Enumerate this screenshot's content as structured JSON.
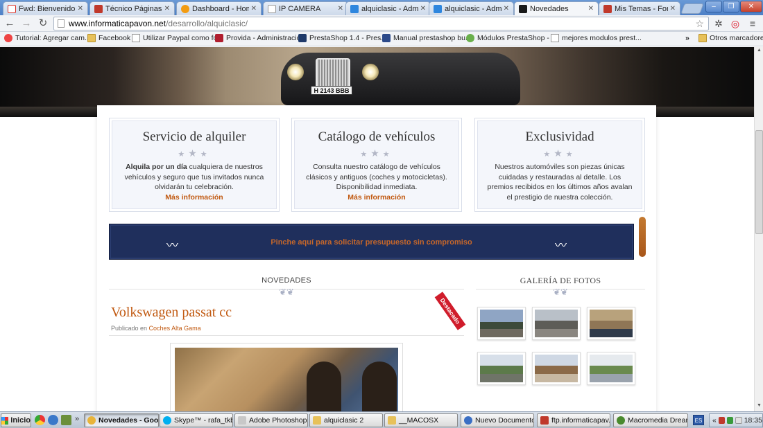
{
  "browser": {
    "tabs": [
      {
        "title": "Fwd: Bienvenido! Pr",
        "favicon_color": "#d93025",
        "active": false
      },
      {
        "title": "Técnico Páginas Joo",
        "favicon_color": "#c0392b",
        "active": false
      },
      {
        "title": "Dashboard - Home",
        "favicon_color": "#f39c12",
        "active": false
      },
      {
        "title": "IP CAMERA",
        "favicon_color": "#ffffff",
        "active": false
      },
      {
        "title": "alquiclasic - Administ",
        "favicon_color": "#2e86de",
        "active": false
      },
      {
        "title": "alquiclasic - Administ",
        "favicon_color": "#2e86de",
        "active": false
      },
      {
        "title": "Novedades",
        "favicon_color": "#1a1a1a",
        "active": true
      },
      {
        "title": "Mis Temas - Foro Jo",
        "favicon_color": "#c0392b",
        "active": false
      }
    ],
    "url_host": "www.informaticapavon.net",
    "url_path": "/desarrollo/alquiclasic/",
    "bookmarks": [
      {
        "label": "Tutorial: Agregar cam...",
        "icon": "joomla-icon"
      },
      {
        "label": "Facebook",
        "icon": "folder-icon"
      },
      {
        "label": "Utilizar Paypal como fo...",
        "icon": "page-icon"
      },
      {
        "label": "Provida - Administración",
        "icon": "provida-icon"
      },
      {
        "label": "PrestaShop 1.4 - Pres...",
        "icon": "prestashop-icon"
      },
      {
        "label": "Manual prestashop bu...",
        "icon": "manual-icon"
      },
      {
        "label": "Módulos PrestaShop - ...",
        "icon": "modules-icon"
      },
      {
        "label": "mejores modulos prest...",
        "icon": "page-icon"
      }
    ],
    "bookmarks_overflow": "»",
    "other_bookmarks": "Otros marcadores"
  },
  "page": {
    "hero_plate": "H 2143 BBB",
    "cards": [
      {
        "title": "Servicio de alquiler",
        "body_bold": "Alquila por un día",
        "body": " cualquiera de nuestros vehículos y seguro que tus invitados nunca olvidarán tu celebración.",
        "link": "Más información"
      },
      {
        "title": "Catálogo de vehículos",
        "body_bold": "",
        "body": "Consulta nuestro catálogo de vehículos clásicos y antiguos (coches y motocicletas). Disponibilidad inmediata.",
        "link": "Más información"
      },
      {
        "title": "Exclusividad",
        "body_bold": "",
        "body": "Nuestros automóviles son piezas únicas cuidadas y restauradas al detalle. Los premios recibidos en los últimos años avalan el prestigio de nuestra colección.",
        "link": ""
      }
    ],
    "banner_text": "Pinche aquí para solicitar presupuesto sin compromiso",
    "novedades_heading": "NOVEDADES",
    "gallery_heading": "GALERÍA DE FOTOS",
    "post": {
      "title": "Volkswagen passat cc",
      "meta_prefix": "Publicado en ",
      "category": "Coches Alta Gama",
      "ribbon": "Destacado"
    },
    "gallery_thumbs": [
      {
        "colors": [
          "#8fa5c4",
          "#3d4a3a",
          "#6f6a60"
        ]
      },
      {
        "colors": [
          "#b9c0c8",
          "#5e5d58",
          "#8a8680"
        ]
      },
      {
        "colors": [
          "#b8a27c",
          "#8f7656",
          "#2f3a4a"
        ]
      },
      {
        "colors": [
          "#d7dfe9",
          "#5c7a4a",
          "#6f7468"
        ]
      },
      {
        "colors": [
          "#cfd8e4",
          "#8b6a48",
          "#c7b8a2"
        ]
      },
      {
        "colors": [
          "#e6eaee",
          "#6a8a4e",
          "#9aa3ad"
        ]
      }
    ]
  },
  "taskbar": {
    "start_label": "Inicio",
    "tasks": [
      {
        "label": "Novedades - Goo...",
        "icon_color": "#e8b43a",
        "active": true
      },
      {
        "label": "Skype™ - rafa_tkb...",
        "icon_color": "#00aff0",
        "active": false
      },
      {
        "label": "Adobe Photoshop",
        "icon_color": "#c8c8c8",
        "active": false
      },
      {
        "label": "alquiclasic 2",
        "icon_color": "#e7c15a",
        "active": false
      },
      {
        "label": "__MACOSX",
        "icon_color": "#e7c15a",
        "active": false
      },
      {
        "label": "Nuevo Documento ...",
        "icon_color": "#3b6fc4",
        "active": false
      },
      {
        "label": "ftp.informaticapav...",
        "icon_color": "#c0392b",
        "active": false
      },
      {
        "label": "Macromedia Dream...",
        "icon_color": "#4a8a2e",
        "active": false
      }
    ],
    "lang": "ES",
    "clock": "18:35",
    "tray_chevron": "«"
  }
}
